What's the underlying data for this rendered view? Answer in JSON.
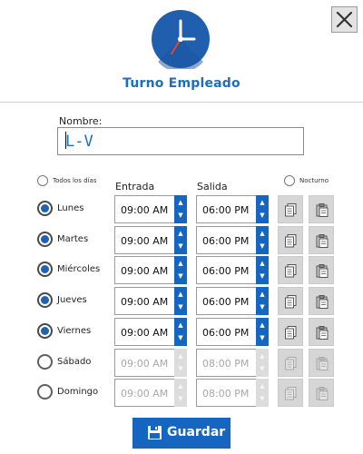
{
  "window": {
    "title": "Turno Empleado"
  },
  "form": {
    "name_label": "Nombre:",
    "name_value": "L-V"
  },
  "options": {
    "all_days_label": "Todos los días",
    "night_label": "Nocturno"
  },
  "columns": {
    "entrada": "Entrada",
    "salida": "Salida"
  },
  "days": [
    {
      "label": "Lunes",
      "selected": true,
      "entrada": "09:00 AM",
      "salida": "06:00 PM"
    },
    {
      "label": "Martes",
      "selected": true,
      "entrada": "09:00 AM",
      "salida": "06:00 PM"
    },
    {
      "label": "Miércoles",
      "selected": true,
      "entrada": "09:00 AM",
      "salida": "06:00 PM"
    },
    {
      "label": "Jueves",
      "selected": true,
      "entrada": "09:00 AM",
      "salida": "06:00 PM"
    },
    {
      "label": "Viernes",
      "selected": true,
      "entrada": "09:00 AM",
      "salida": "06:00 PM"
    },
    {
      "label": "Sábado",
      "selected": false,
      "entrada": "09:00 AM",
      "salida": "08:00 PM"
    },
    {
      "label": "Domingo",
      "selected": false,
      "entrada": "09:00 AM",
      "salida": "08:00 PM"
    }
  ],
  "spin": {
    "up": "▲",
    "down": "▼"
  },
  "actions": {
    "save_label": "Guardar"
  },
  "colors": {
    "accent": "#1566c0",
    "title": "#1a6fbf",
    "clock_face": "#1f5fae"
  },
  "icons": {
    "close": "close-icon",
    "clock": "clock-icon",
    "copy": "copy-icon",
    "paste": "paste-icon",
    "save": "floppy-disk-icon"
  }
}
